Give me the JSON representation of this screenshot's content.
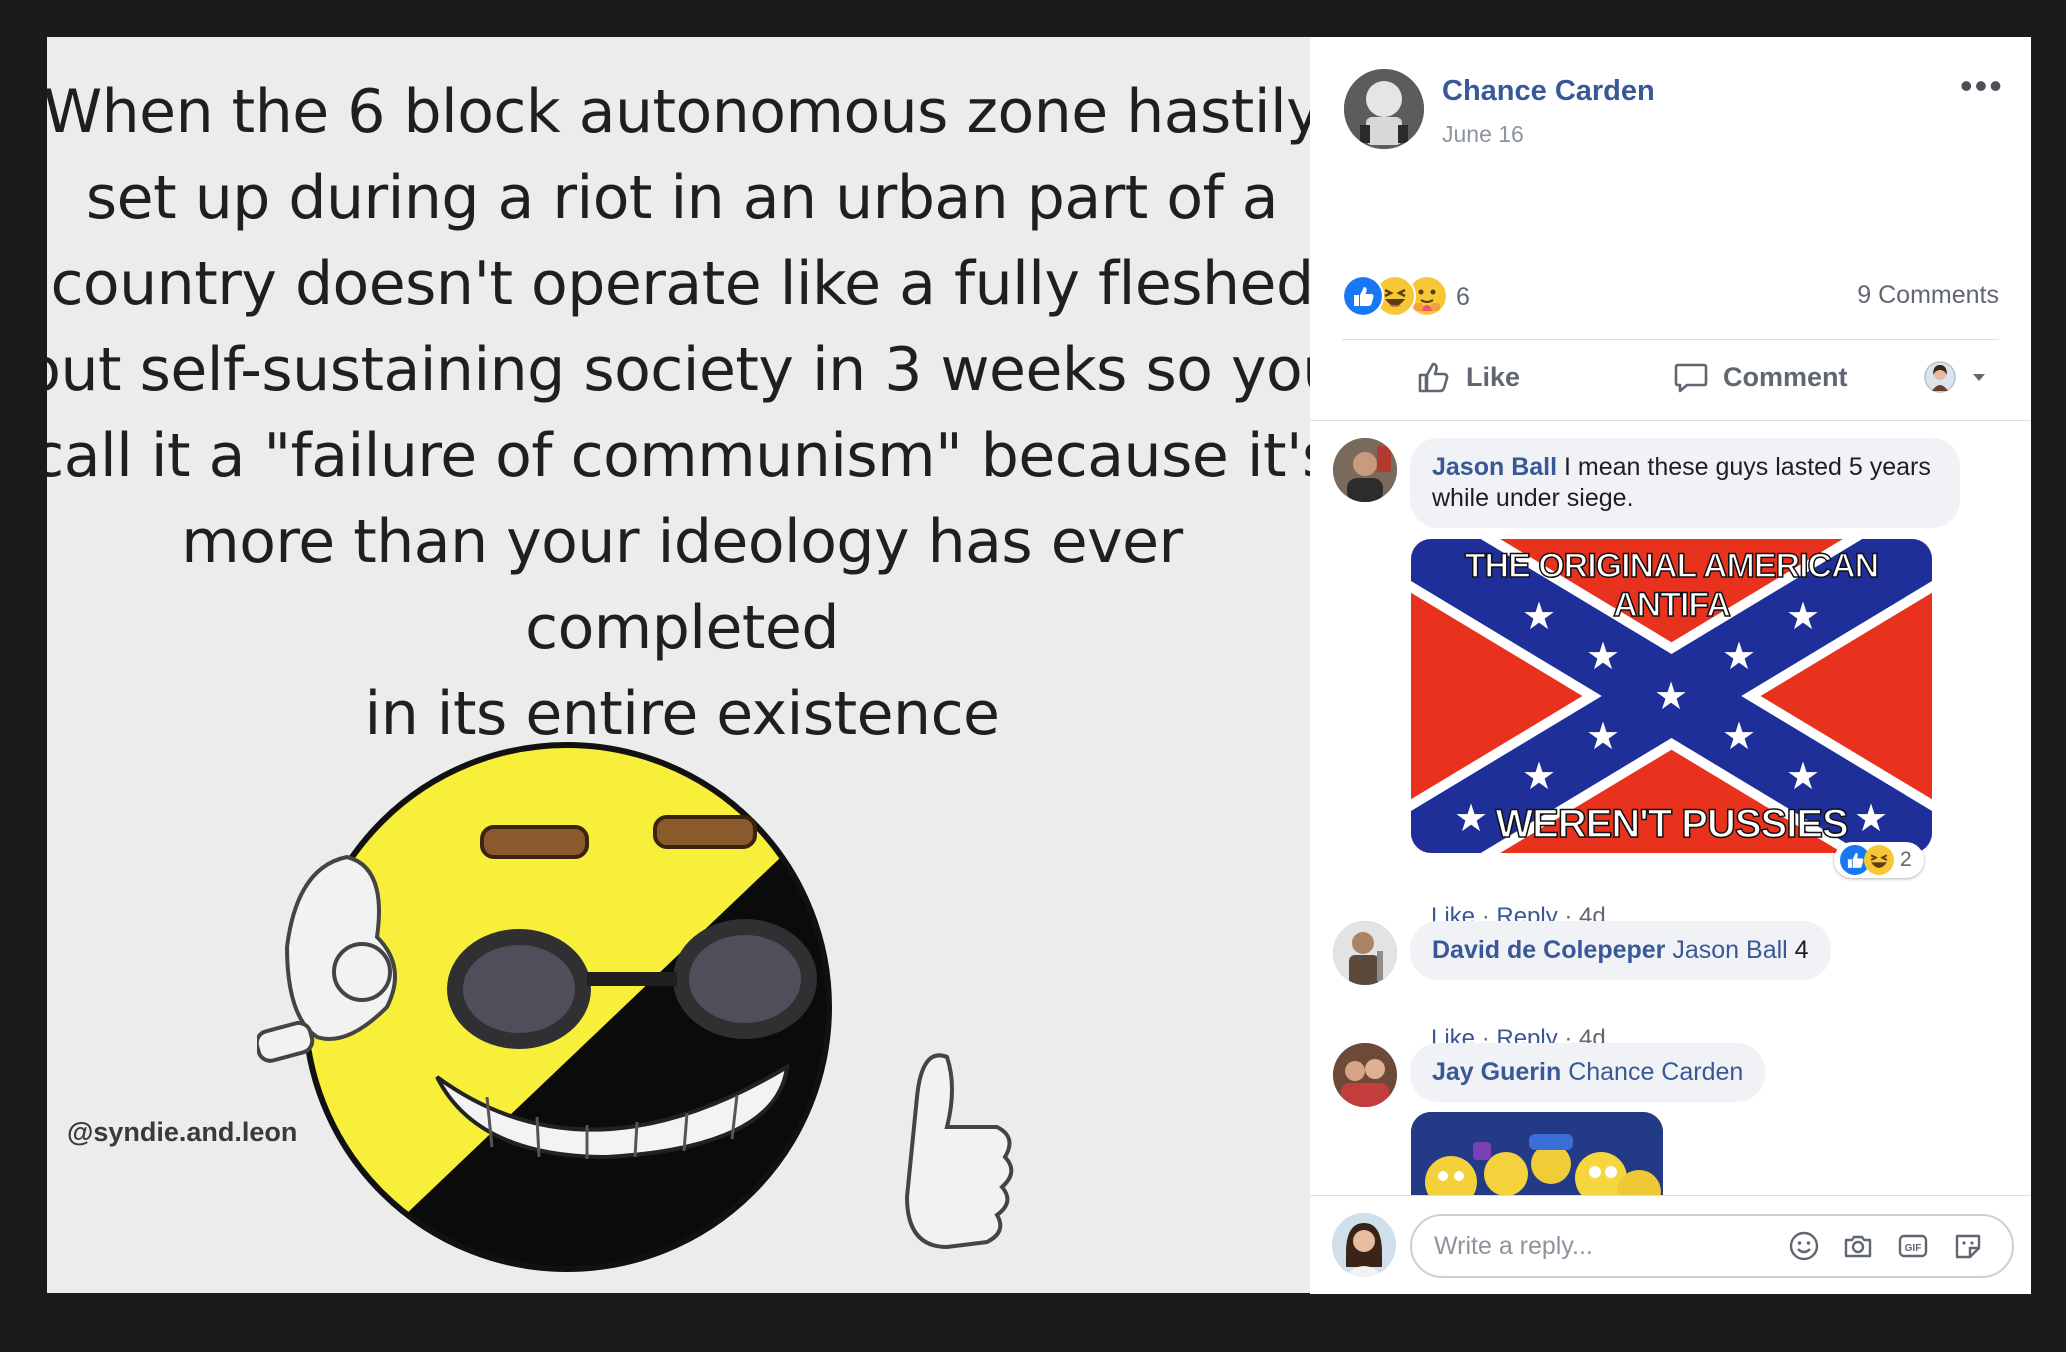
{
  "meme": {
    "text": "When the 6 block autonomous zone hastily\nset up during a riot in an urban part of a\ncountry doesn't operate like a fully fleshed\nout self-sustaining society in 3 weeks so you\ncall it a \"failure of communism\" because it's\nmore than your ideology has ever completed\nin its entire existence",
    "credit": "@syndie.and.leon"
  },
  "post": {
    "author": "Chance Carden",
    "date": "June 16",
    "more": "•••",
    "reaction_count": "6",
    "comments_count": "9 Comments",
    "reactions": [
      "like-reaction-icon",
      "haha-reaction-icon",
      "care-reaction-icon"
    ]
  },
  "actions": {
    "like": "Like",
    "comment": "Comment"
  },
  "comments": [
    {
      "author": "Jason Ball",
      "text": "I mean these guys lasted 5 years while under siege.",
      "image_top": "THE ORIGINAL AMERICAN ANTIFA",
      "image_bottom": "WEREN'T PUSSIES",
      "like": "Like",
      "reply": "Reply",
      "age": "4d",
      "reaction_count": "2"
    },
    {
      "author": "David de Colepeper",
      "mention": "Jason Ball",
      "text": "4",
      "like": "Like",
      "reply": "Reply",
      "age": "4d"
    },
    {
      "author": "Jay Guerin",
      "mention": "Chance Carden"
    }
  ],
  "reply_box": {
    "placeholder": "Write a reply..."
  },
  "colors": {
    "link": "#385898",
    "secondary_text": "#606770",
    "bubble_bg": "#f0f2f5",
    "like_blue": "#1877f2"
  }
}
